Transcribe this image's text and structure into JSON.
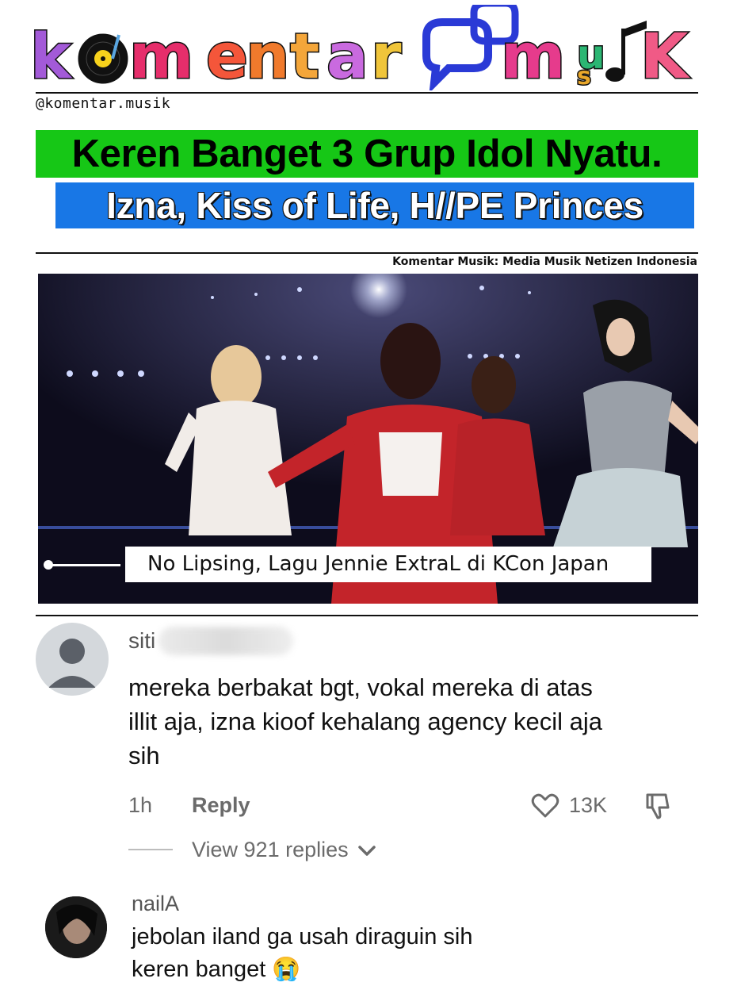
{
  "brand": {
    "logo_text": "komentar musik",
    "logo_part1": "komentar",
    "logo_part2": "musik",
    "handle": "@komentar.musik",
    "tagline": "Komentar Musik: Media Musik Netizen Indonesia"
  },
  "headline": {
    "line1": "Keren Banget 3 Grup Idol Nyatu.",
    "line2": "Izna, Kiss of Life, H//PE Princes"
  },
  "video": {
    "caption": "No Lipsing, Lagu Jennie ExtraL di KCon Japan"
  },
  "comments": [
    {
      "username": "siti",
      "text_lines": [
        "mereka berbakat bgt, vokal mereka di atas",
        "illit aja, izna kioof kehalang agency kecil aja",
        "sih"
      ],
      "time": "1h",
      "reply_label": "Reply",
      "likes": "13K",
      "view_replies": "View 921 replies"
    },
    {
      "username": "nailA",
      "text_lines": [
        "jebolan iland ga usah diraguin sih",
        "keren banget 😭"
      ]
    }
  ],
  "colors": {
    "headline1_bg": "#16c716",
    "headline2_bg": "#1877e6",
    "logo_k": "#a35ad8",
    "logo_m": "#e62e6b",
    "logo_e": "#f4563a",
    "logo_n": "#f07a2c",
    "logo_t": "#f4a63a",
    "logo_a": "#c96adf",
    "logo_r": "#f0c53a",
    "logo_bubble": "#2a3ad6"
  }
}
